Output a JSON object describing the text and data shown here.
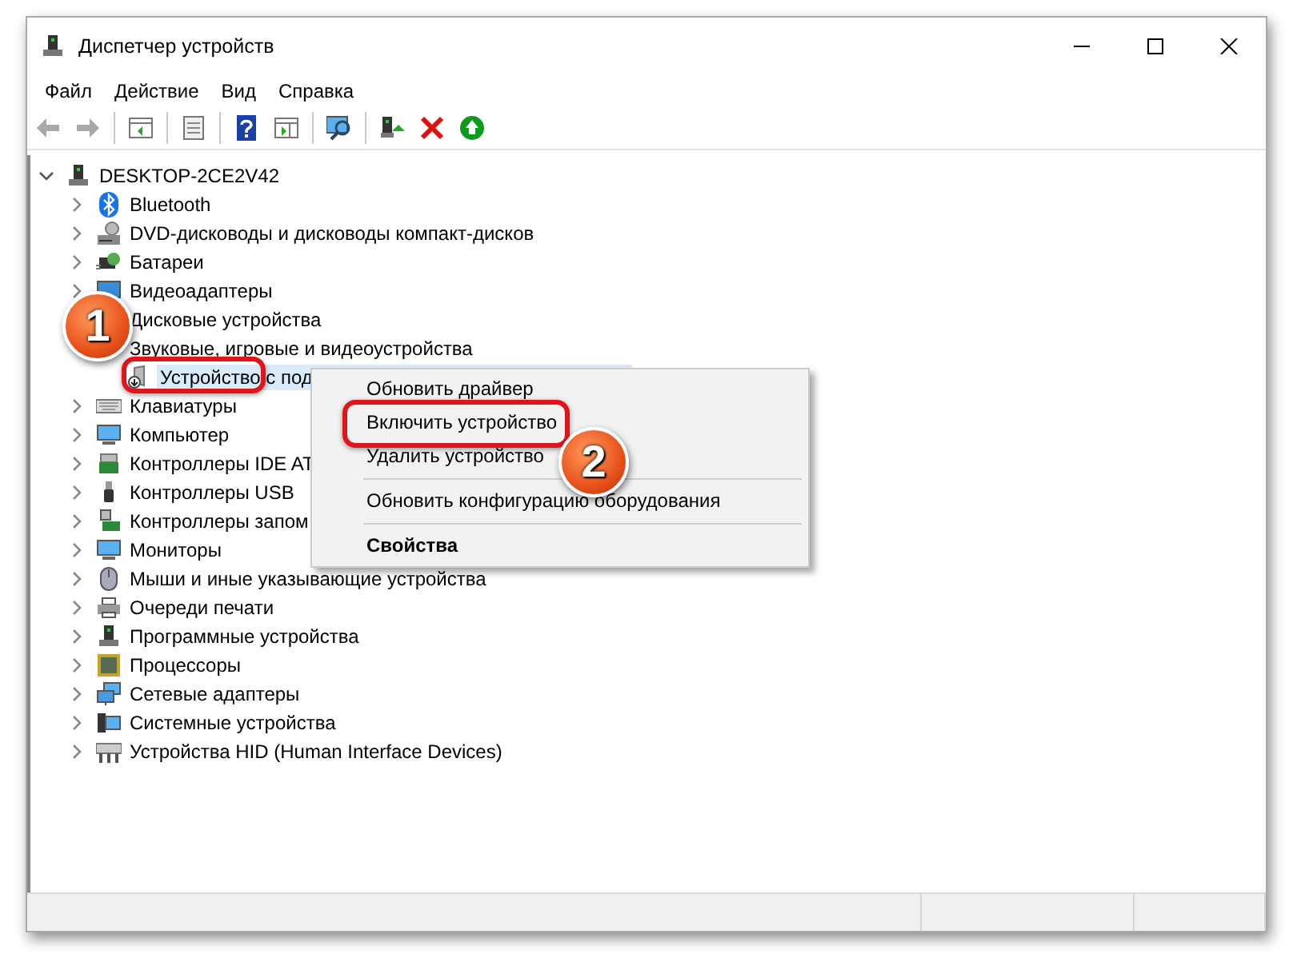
{
  "window": {
    "title": "Диспетчер устройств"
  },
  "menu_bar": [
    "Файл",
    "Действие",
    "Вид",
    "Справка"
  ],
  "toolbar": [
    {
      "kind": "back",
      "disabled": true
    },
    {
      "kind": "forward",
      "disabled": true
    },
    {
      "kind": "separator"
    },
    {
      "kind": "tree-pane",
      "disabled": false
    },
    {
      "kind": "separator"
    },
    {
      "kind": "properties",
      "disabled": false
    },
    {
      "kind": "separator"
    },
    {
      "kind": "help",
      "disabled": false
    },
    {
      "kind": "action-pane",
      "disabled": false
    },
    {
      "kind": "separator"
    },
    {
      "kind": "scan",
      "disabled": false
    },
    {
      "kind": "separator"
    },
    {
      "kind": "update",
      "disabled": false
    },
    {
      "kind": "uninstall",
      "disabled": false
    },
    {
      "kind": "enable",
      "disabled": false
    }
  ],
  "tree": [
    {
      "label": "DESKTOP-2CE2V42",
      "kind": "computer",
      "expanded": true,
      "selected": false,
      "children": [
        {
          "label": "Bluetooth",
          "kind": "bluetooth",
          "expanded": false,
          "selected": false
        },
        {
          "label": "DVD-дисководы и дисководы компакт-дисков",
          "kind": "disc",
          "expanded": false,
          "selected": false
        },
        {
          "label": "Батареи",
          "kind": "battery",
          "expanded": false,
          "selected": false
        },
        {
          "label": "Видеоадаптеры",
          "kind": "display",
          "expanded": false,
          "selected": false
        },
        {
          "label": "Дисковые устройства",
          "selected": false
        },
        {
          "label": "Звуковые, игровые и видеоустройства",
          "selected": false,
          "children": [
            {
              "label": "Устройство с под",
              "kind": "speaker",
              "selected": true
            }
          ]
        },
        {
          "label": "Клавиатуры",
          "kind": "keyboard",
          "expanded": false,
          "selected": false
        },
        {
          "label": "Компьютер",
          "kind": "monitor",
          "expanded": false,
          "selected": false
        },
        {
          "label": "Контроллеры IDE AT",
          "kind": "controller",
          "expanded": false,
          "selected": false
        },
        {
          "label": "Контроллеры USB",
          "kind": "usb",
          "expanded": false,
          "selected": false
        },
        {
          "label": "Контроллеры запом",
          "kind": "storage",
          "expanded": false,
          "selected": false
        },
        {
          "label": "Мониторы",
          "kind": "monitor",
          "expanded": false,
          "selected": false
        },
        {
          "label": "Мыши и иные указывающие устройства",
          "kind": "mouse",
          "expanded": false,
          "selected": false
        },
        {
          "label": "Очереди печати",
          "kind": "printer",
          "expanded": false,
          "selected": false
        },
        {
          "label": "Программные устройства",
          "kind": "computer",
          "expanded": false,
          "selected": false
        },
        {
          "label": "Процессоры",
          "kind": "cpu",
          "expanded": false,
          "selected": false
        },
        {
          "label": "Сетевые адаптеры",
          "kind": "network",
          "expanded": false,
          "selected": false
        },
        {
          "label": "Системные устройства",
          "kind": "system",
          "expanded": false,
          "selected": false
        },
        {
          "label": "Устройства HID (Human Interface Devices)",
          "kind": "hid",
          "expanded": false,
          "selected": false
        }
      ]
    }
  ],
  "context_menu": [
    {
      "kind": "item",
      "label": "Обновить драйвер",
      "default": false
    },
    {
      "kind": "item",
      "label": "Включить устройство",
      "default": false
    },
    {
      "kind": "item",
      "label": "Удалить устройство",
      "default": false
    },
    {
      "kind": "separator"
    },
    {
      "kind": "item",
      "label": "Обновить конфигурацию оборудования",
      "default": false
    },
    {
      "kind": "separator"
    },
    {
      "kind": "item",
      "label": "Свойства",
      "default": true
    }
  ],
  "annotations": [
    {
      "label": "1"
    },
    {
      "label": "2"
    }
  ]
}
